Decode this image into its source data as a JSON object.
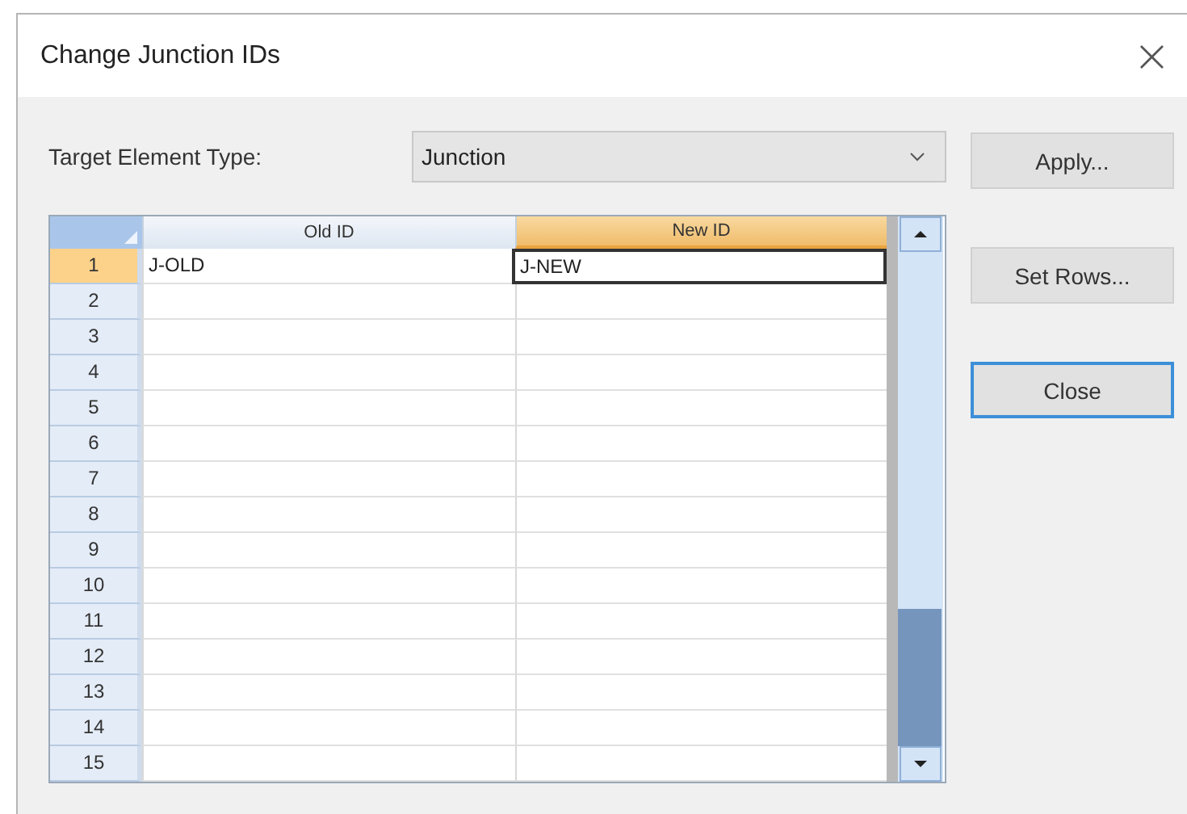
{
  "window": {
    "title": "Change Junction IDs",
    "close": "×"
  },
  "target": {
    "label": "Target Element Type:",
    "value": "Junction"
  },
  "grid": {
    "columns": [
      {
        "label": "Old ID",
        "selected": false
      },
      {
        "label": "New ID",
        "selected": true
      }
    ],
    "rows": [
      {
        "number": "1",
        "old_id": "J-OLD",
        "new_id": "J-NEW",
        "selected": true
      },
      {
        "number": "2",
        "selected": false
      },
      {
        "number": "3",
        "selected": false
      },
      {
        "number": "4",
        "selected": false
      },
      {
        "number": "5",
        "selected": false
      },
      {
        "number": "6",
        "selected": false
      },
      {
        "number": "7",
        "selected": false
      },
      {
        "number": "8",
        "selected": false
      },
      {
        "number": "9",
        "selected": false
      },
      {
        "number": "10",
        "selected": false
      },
      {
        "number": "11",
        "selected": false
      },
      {
        "number": "12",
        "selected": false
      },
      {
        "number": "13",
        "selected": false
      },
      {
        "number": "14",
        "selected": false
      },
      {
        "number": "15",
        "selected": false
      }
    ]
  },
  "buttons": [
    {
      "label": "Apply...",
      "focused": false
    },
    {
      "label": "Set Rows...",
      "focused": false
    },
    {
      "label": "Close",
      "focused": true
    }
  ]
}
